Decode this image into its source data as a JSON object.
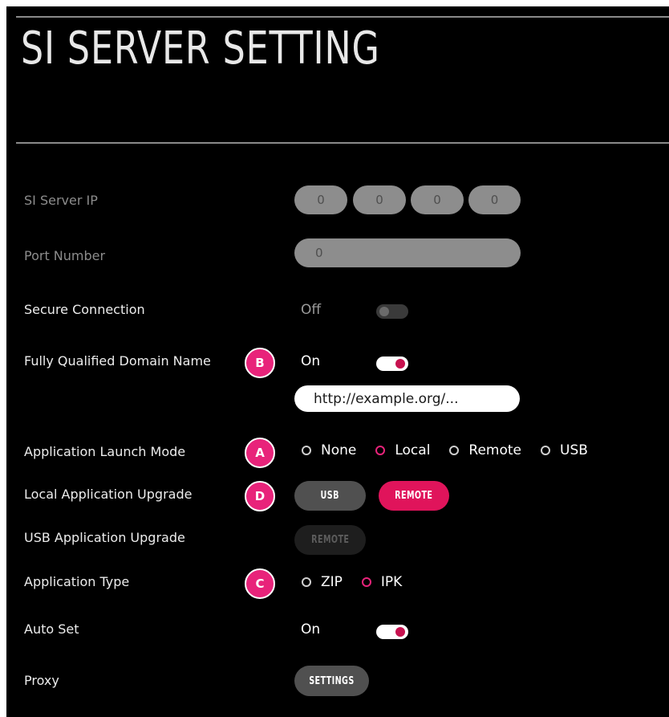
{
  "title": "SI SERVER SETTING",
  "rows": {
    "si_server_ip": {
      "label": "SI Server IP",
      "octets": [
        "0",
        "0",
        "0",
        "0"
      ]
    },
    "port_number": {
      "label": "Port Number",
      "value": "0"
    },
    "secure_connection": {
      "label": "Secure Connection",
      "state": "Off"
    },
    "fqdn": {
      "label": "Fully Qualified Domain Name",
      "badge": "B",
      "state": "On",
      "url": "http://example.org/..."
    },
    "app_launch_mode": {
      "label": "Application Launch Mode",
      "badge": "A",
      "options": [
        "None",
        "Local",
        "Remote",
        "USB"
      ],
      "selected": "Local"
    },
    "local_app_upgrade": {
      "label": "Local Application Upgrade",
      "badge": "D",
      "buttons": [
        "USB",
        "REMOTE"
      ],
      "selected": "REMOTE"
    },
    "usb_app_upgrade": {
      "label": "USB Application Upgrade",
      "button": "REMOTE"
    },
    "app_type": {
      "label": "Application Type",
      "badge": "C",
      "options": [
        "ZIP",
        "IPK"
      ],
      "selected": "IPK"
    },
    "auto_set": {
      "label": "Auto Set",
      "state": "On"
    },
    "proxy": {
      "label": "Proxy",
      "button": "SETTINGS"
    }
  },
  "colors": {
    "accent": "#e0145b",
    "badge": "#e8237a",
    "background": "#000000"
  }
}
